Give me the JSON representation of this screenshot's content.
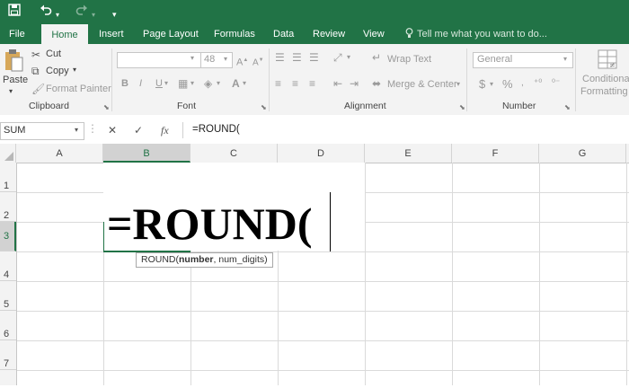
{
  "quick_access": {
    "save_icon": "save-icon",
    "undo_icon": "undo-icon",
    "redo_icon": "redo-icon",
    "customize_icon": "customize-icon"
  },
  "tabs": [
    {
      "label": "File"
    },
    {
      "label": "Home"
    },
    {
      "label": "Insert"
    },
    {
      "label": "Page Layout"
    },
    {
      "label": "Formulas"
    },
    {
      "label": "Data"
    },
    {
      "label": "Review"
    },
    {
      "label": "View"
    }
  ],
  "tell_me": "Tell me what you want to do...",
  "ribbon": {
    "clipboard": {
      "paste": "Paste",
      "cut": "Cut",
      "copy": "Copy",
      "format_painter": "Format Painter",
      "label": "Clipboard"
    },
    "font": {
      "size": "48",
      "bold": "B",
      "italic": "I",
      "underline": "U",
      "label": "Font"
    },
    "alignment": {
      "wrap_text": "Wrap Text",
      "merge_center": "Merge & Center",
      "label": "Alignment"
    },
    "number": {
      "format": "General",
      "currency": "$",
      "percent": "%",
      "label": "Number"
    },
    "styles": {
      "line1": "Conditional",
      "line2": "Formatting"
    }
  },
  "formula_bar": {
    "name_box": "SUM",
    "cancel": "✕",
    "enter": "✓",
    "fx": "fx",
    "formula": "=ROUND("
  },
  "columns": [
    "A",
    "B",
    "C",
    "D",
    "E",
    "F",
    "G"
  ],
  "rows": [
    "1",
    "2",
    "3",
    "4",
    "5",
    "6",
    "7"
  ],
  "cell": {
    "content": "=ROUND("
  },
  "tooltip": {
    "func": "ROUND(",
    "arg1": "number",
    "rest": ", num_digits)"
  },
  "colors": {
    "excel_green": "#217346",
    "ribbon_bg": "#f3f3f3"
  }
}
